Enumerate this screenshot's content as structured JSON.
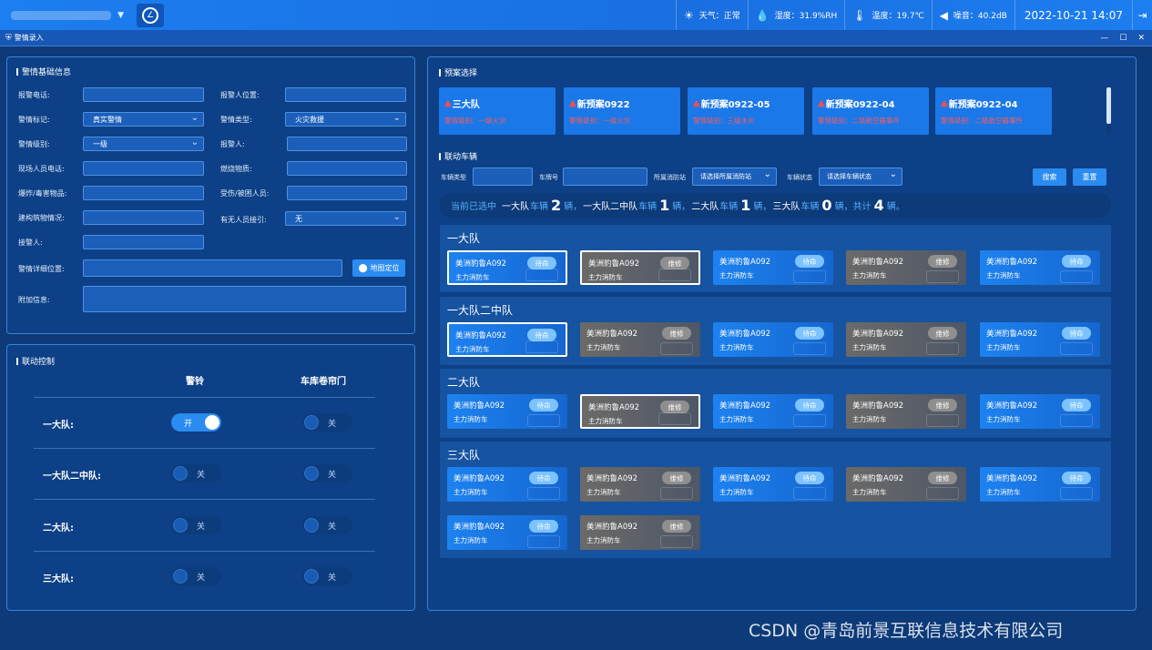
{
  "topbar": {
    "weather_label": "天气：正常",
    "humidity_label": "湿度：31.9%RH",
    "temperature_label": "温度：19.7℃",
    "noise_label": "噪音：40.2dB",
    "datetime": "2022-10-21 14:07"
  },
  "window": {
    "title": "警情录入"
  },
  "alarm_info": {
    "title": "警情基础信息",
    "fields": {
      "caller_phone": "报警电话:",
      "caller_location": "报警人位置:",
      "alarm_tag": "警情标记:",
      "alarm_tag_value": "真实警情",
      "alarm_type": "警情类型:",
      "alarm_type_value": "火灾救援",
      "alarm_level": "警情级别:",
      "alarm_level_value": "一级",
      "caller": "报警人:",
      "onsite_phone": "现场人员电话:",
      "burning_material": "燃烧物质:",
      "explosive": "爆炸/毒害物品:",
      "injured": "受伤/被困人员:",
      "building": "建构筑物情况:",
      "guide": "有无人员接引:",
      "guide_value": "无",
      "receiver": "接警人:",
      "detail_location": "警情详细位置:",
      "extra_info": "附加信息:"
    },
    "map_button": "地图定位"
  },
  "linkage_control": {
    "title": "联动控制",
    "col_alarm": "警铃",
    "col_garage": "车库卷帘门",
    "rows": [
      {
        "name": "一大队:",
        "alarm": "开",
        "garage": "关"
      },
      {
        "name": "一大队二中队:",
        "alarm": "关",
        "garage": "关"
      },
      {
        "name": "二大队:",
        "alarm": "关",
        "garage": "关"
      },
      {
        "name": "三大队:",
        "alarm": "关",
        "garage": "关"
      }
    ]
  },
  "plans": {
    "title": "预案选择",
    "items": [
      {
        "name": "三大队",
        "level": "警情级别：一级火灾"
      },
      {
        "name": "新预案0922",
        "level": "警情级别：一级火灾"
      },
      {
        "name": "新预案0922-05",
        "level": "警情级别：三级水灾"
      },
      {
        "name": "新预案0922-04",
        "level": "警情级别：二级航空器事件"
      },
      {
        "name": "新预案0922-04",
        "level": "警情级别：二级航空器事件"
      }
    ]
  },
  "vehicles": {
    "title": "联动车辆",
    "filter": {
      "type_label": "车辆类型",
      "plate_label": "车牌号",
      "station_label": "所属消防站",
      "station_placeholder": "请选择所属消防站",
      "status_label": "车辆状态",
      "status_placeholder": "请选择车辆状态",
      "search": "搜索",
      "reset": "重置"
    },
    "summary": {
      "prefix": "当前已选中",
      "g1": "一大队",
      "g2": "一大队二中队",
      "g3": "二大队",
      "g4": "三大队",
      "unit_vehicle": "车辆",
      "unit_count": "辆，",
      "c1": "2",
      "c2": "1",
      "c3": "1",
      "c4": "0",
      "total_label": "共计",
      "total": "4",
      "total_suffix": "辆。"
    },
    "groups": [
      {
        "name": "一大队",
        "vehicles": [
          {
            "plate": "美洲豹鲁A092",
            "type": "主力消防车",
            "status": "待命",
            "s": 0,
            "selected": true
          },
          {
            "plate": "美洲豹鲁A092",
            "type": "主力消防车",
            "status": "维修",
            "s": 1,
            "selected": true
          },
          {
            "plate": "美洲豹鲁A092",
            "type": "主力消防车",
            "status": "待命",
            "s": 0,
            "selected": false
          },
          {
            "plate": "美洲豹鲁A092",
            "type": "主力消防车",
            "status": "维修",
            "s": 1,
            "selected": false
          },
          {
            "plate": "美洲豹鲁A092",
            "type": "主力消防车",
            "status": "待命",
            "s": 0,
            "selected": false
          }
        ]
      },
      {
        "name": "一大队二中队",
        "vehicles": [
          {
            "plate": "美洲豹鲁A092",
            "type": "主力消防车",
            "status": "待命",
            "s": 0,
            "selected": true
          },
          {
            "plate": "美洲豹鲁A092",
            "type": "主力消防车",
            "status": "维修",
            "s": 1,
            "selected": false
          },
          {
            "plate": "美洲豹鲁A092",
            "type": "主力消防车",
            "status": "待命",
            "s": 0,
            "selected": false
          },
          {
            "plate": "美洲豹鲁A092",
            "type": "主力消防车",
            "status": "维修",
            "s": 1,
            "selected": false
          },
          {
            "plate": "美洲豹鲁A092",
            "type": "主力消防车",
            "status": "待命",
            "s": 0,
            "selected": false
          }
        ]
      },
      {
        "name": "二大队",
        "vehicles": [
          {
            "plate": "美洲豹鲁A092",
            "type": "主力消防车",
            "status": "待命",
            "s": 0,
            "selected": false
          },
          {
            "plate": "美洲豹鲁A092",
            "type": "主力消防车",
            "status": "维修",
            "s": 1,
            "selected": true
          },
          {
            "plate": "美洲豹鲁A092",
            "type": "主力消防车",
            "status": "待命",
            "s": 0,
            "selected": false
          },
          {
            "plate": "美洲豹鲁A092",
            "type": "主力消防车",
            "status": "维修",
            "s": 1,
            "selected": false
          },
          {
            "plate": "美洲豹鲁A092",
            "type": "主力消防车",
            "status": "待命",
            "s": 0,
            "selected": false
          }
        ]
      },
      {
        "name": "三大队",
        "vehicles": [
          {
            "plate": "美洲豹鲁A092",
            "type": "主力消防车",
            "status": "待命",
            "s": 0,
            "selected": false
          },
          {
            "plate": "美洲豹鲁A092",
            "type": "主力消防车",
            "status": "维修",
            "s": 1,
            "selected": false
          },
          {
            "plate": "美洲豹鲁A092",
            "type": "主力消防车",
            "status": "待命",
            "s": 0,
            "selected": false
          },
          {
            "plate": "美洲豹鲁A092",
            "type": "主力消防车",
            "status": "维修",
            "s": 1,
            "selected": false
          },
          {
            "plate": "美洲豹鲁A092",
            "type": "主力消防车",
            "status": "待命",
            "s": 0,
            "selected": false
          },
          {
            "plate": "美洲豹鲁A092",
            "type": "主力消防车",
            "status": "待命",
            "s": 0,
            "selected": false
          },
          {
            "plate": "美洲豹鲁A092",
            "type": "主力消防车",
            "status": "维修",
            "s": 1,
            "selected": false
          }
        ]
      }
    ]
  },
  "watermark": "CSDN @青岛前景互联信息技术有限公司"
}
